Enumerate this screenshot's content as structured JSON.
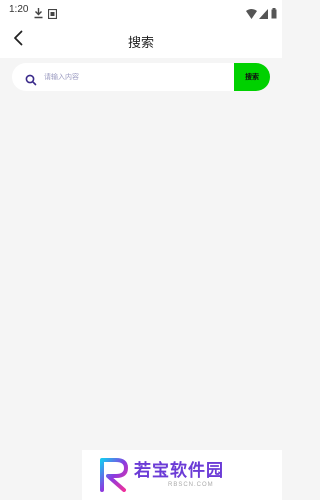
{
  "status_bar": {
    "time": "1:20"
  },
  "nav": {
    "title": "搜索"
  },
  "search": {
    "placeholder": "请输入内容",
    "value": "",
    "button_label": "搜索"
  },
  "watermark": {
    "name": "若宝软件园",
    "url": "RBSCN.COM"
  },
  "colors": {
    "accent": "#00d100",
    "background": "#f5f5f5"
  }
}
